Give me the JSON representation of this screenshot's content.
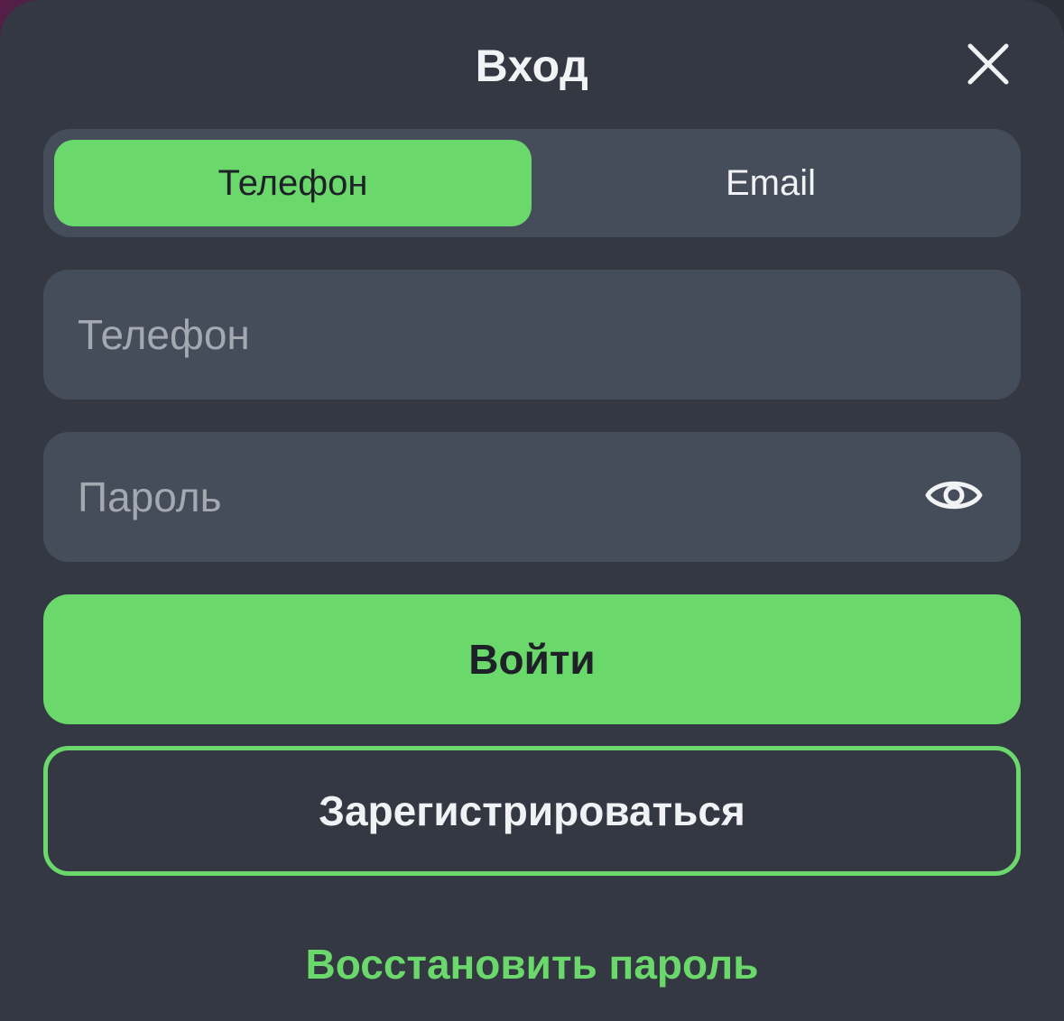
{
  "modal": {
    "title": "Вход",
    "close_icon": "close-icon"
  },
  "login_method_tabs": [
    {
      "label": "Телефон",
      "selected": true
    },
    {
      "label": "Email",
      "selected": false
    }
  ],
  "phone_field": {
    "placeholder": "Телефон",
    "value": ""
  },
  "password_field": {
    "placeholder": "Пароль",
    "value": "",
    "toggle_icon": "eye-icon"
  },
  "buttons": {
    "login_label": "Войти",
    "register_label": "Зарегистрироваться",
    "restore_label": "Восстановить пароль"
  },
  "colors": {
    "accent": "#6ad86a",
    "modal_background": "#343843",
    "field_background": "#464d5a",
    "text_primary": "#f0f2f5",
    "text_placeholder": "#a3a8b1",
    "text_on_accent": "#1e2228"
  }
}
